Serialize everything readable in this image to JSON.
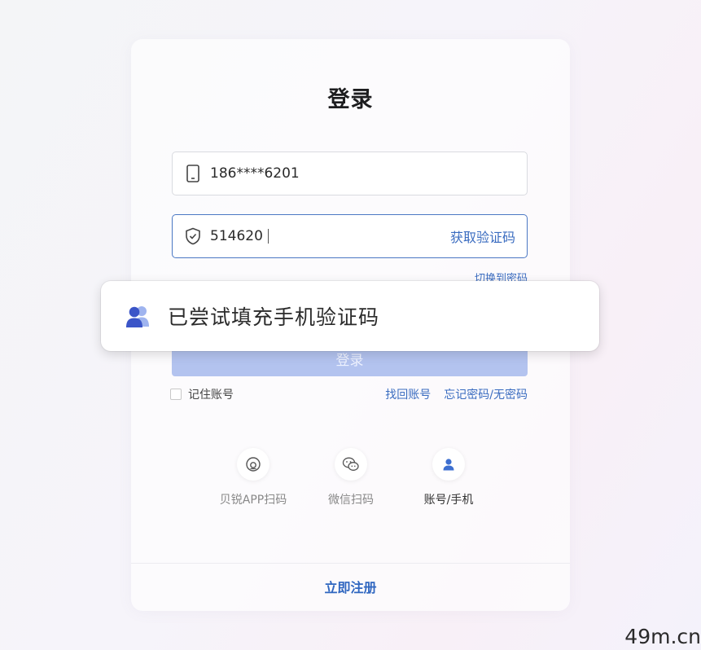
{
  "login": {
    "title": "登录",
    "phone_value": "186****6201",
    "code_value": "514620",
    "get_code_label": "获取验证码",
    "switch_password_label": "切换到密码",
    "login_button": "登录",
    "remember_label": "记住账号",
    "find_account_label": "找回账号",
    "forgot_password_label": "忘记密码/无密码",
    "methods": [
      {
        "label": "贝锐APP扫码",
        "icon": "app-scan-icon"
      },
      {
        "label": "微信扫码",
        "icon": "wechat-icon"
      },
      {
        "label": "账号/手机",
        "icon": "user-icon",
        "active": true
      }
    ],
    "register_label": "立即注册"
  },
  "toast": {
    "message": "已尝试填充手机验证码",
    "icon": "users-icon"
  },
  "watermark": "49m.cn",
  "colors": {
    "accent": "#3a6cc0",
    "focus_border": "#4b78c4",
    "login_button_disabled": "#b3c3ef",
    "toast_icon": "#3b55c8"
  }
}
